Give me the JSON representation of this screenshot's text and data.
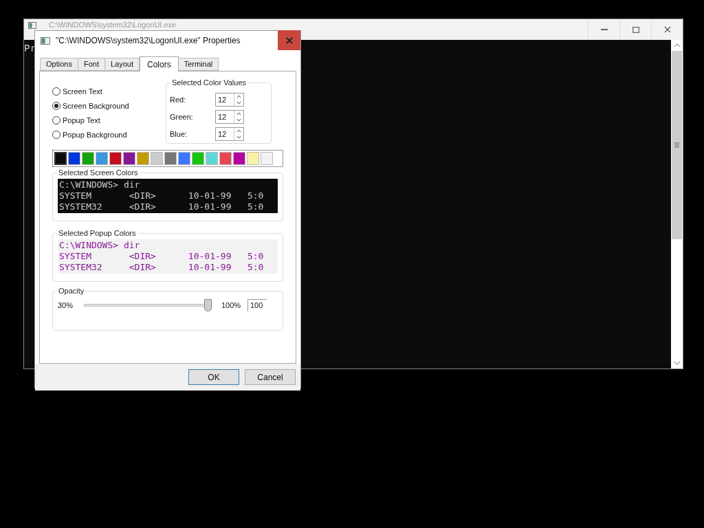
{
  "console": {
    "title": "C:\\WINDOWS\\system32\\LogonUI.exe",
    "text": "Pr"
  },
  "dialog": {
    "title": "\"C:\\WINDOWS\\system32\\LogonUI.exe\" Properties",
    "tabs": [
      {
        "label": "Options",
        "selected": false
      },
      {
        "label": "Font",
        "selected": false
      },
      {
        "label": "Layout",
        "selected": false
      },
      {
        "label": "Colors",
        "selected": true
      },
      {
        "label": "Terminal",
        "selected": false
      }
    ],
    "targets": [
      {
        "label": "Screen Text",
        "selected": false
      },
      {
        "label": "Screen Background",
        "selected": true
      },
      {
        "label": "Popup Text",
        "selected": false
      },
      {
        "label": "Popup Background",
        "selected": false
      }
    ],
    "color_values": {
      "title": "Selected Color Values",
      "fields": [
        {
          "label": "Red:",
          "value": "12"
        },
        {
          "label": "Green:",
          "value": "12"
        },
        {
          "label": "Blue:",
          "value": "12"
        }
      ]
    },
    "palette": [
      {
        "color": "#0c0c0c",
        "selected": true
      },
      {
        "color": "#0037da",
        "selected": false
      },
      {
        "color": "#13a10e",
        "selected": false
      },
      {
        "color": "#3a96dd",
        "selected": false
      },
      {
        "color": "#c50f1f",
        "selected": false
      },
      {
        "color": "#881798",
        "selected": false
      },
      {
        "color": "#c19c00",
        "selected": false
      },
      {
        "color": "#cccccc",
        "selected": false
      },
      {
        "color": "#767676",
        "selected": false
      },
      {
        "color": "#3b78ff",
        "selected": false
      },
      {
        "color": "#16c60c",
        "selected": false
      },
      {
        "color": "#61d6d6",
        "selected": false
      },
      {
        "color": "#e74856",
        "selected": false
      },
      {
        "color": "#b4009e",
        "selected": false
      },
      {
        "color": "#f9f1a5",
        "selected": false
      },
      {
        "color": "#f2f2f2",
        "selected": false
      }
    ],
    "screen_preview": {
      "title": "Selected Screen Colors",
      "lines": [
        "C:\\WINDOWS> dir",
        "SYSTEM       <DIR>      10-01-99   5:0",
        "SYSTEM32     <DIR>      10-01-99   5:0"
      ]
    },
    "popup_preview": {
      "title": "Selected Popup Colors",
      "lines": [
        "C:\\WINDOWS> dir",
        "SYSTEM       <DIR>      10-01-99   5:0",
        "SYSTEM32     <DIR>      10-01-99   5:0"
      ]
    },
    "opacity": {
      "title": "Opacity",
      "min_label": "30%",
      "max_label": "100%",
      "level": 1,
      "value": "100"
    },
    "buttons": [
      {
        "label": "OK",
        "kind": "default"
      },
      {
        "label": "Cancel",
        "kind": "normal"
      }
    ]
  }
}
